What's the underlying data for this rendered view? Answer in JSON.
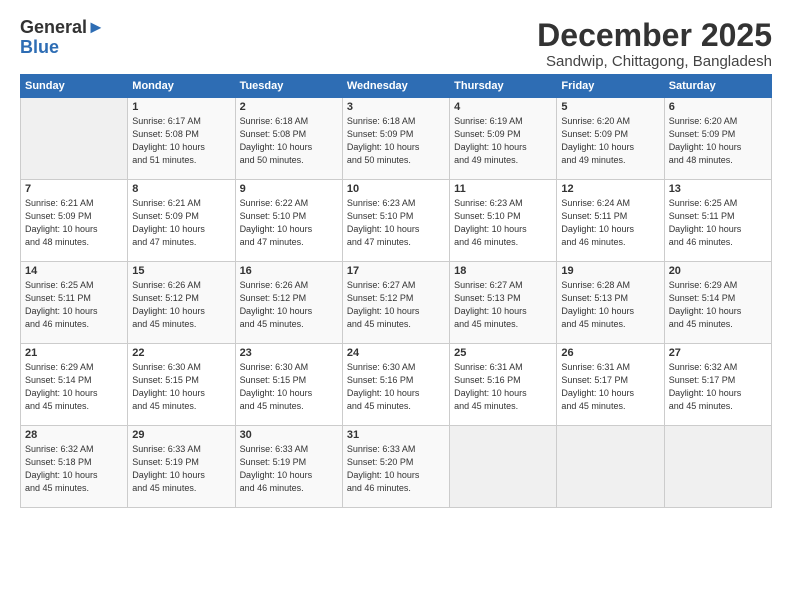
{
  "logo": {
    "general": "General",
    "blue": "Blue"
  },
  "title": "December 2025",
  "location": "Sandwip, Chittagong, Bangladesh",
  "days_of_week": [
    "Sunday",
    "Monday",
    "Tuesday",
    "Wednesday",
    "Thursday",
    "Friday",
    "Saturday"
  ],
  "weeks": [
    [
      {
        "day": "",
        "data": ""
      },
      {
        "day": "1",
        "data": "Sunrise: 6:17 AM\nSunset: 5:08 PM\nDaylight: 10 hours\nand 51 minutes."
      },
      {
        "day": "2",
        "data": "Sunrise: 6:18 AM\nSunset: 5:08 PM\nDaylight: 10 hours\nand 50 minutes."
      },
      {
        "day": "3",
        "data": "Sunrise: 6:18 AM\nSunset: 5:09 PM\nDaylight: 10 hours\nand 50 minutes."
      },
      {
        "day": "4",
        "data": "Sunrise: 6:19 AM\nSunset: 5:09 PM\nDaylight: 10 hours\nand 49 minutes."
      },
      {
        "day": "5",
        "data": "Sunrise: 6:20 AM\nSunset: 5:09 PM\nDaylight: 10 hours\nand 49 minutes."
      },
      {
        "day": "6",
        "data": "Sunrise: 6:20 AM\nSunset: 5:09 PM\nDaylight: 10 hours\nand 48 minutes."
      }
    ],
    [
      {
        "day": "7",
        "data": "Sunrise: 6:21 AM\nSunset: 5:09 PM\nDaylight: 10 hours\nand 48 minutes."
      },
      {
        "day": "8",
        "data": "Sunrise: 6:21 AM\nSunset: 5:09 PM\nDaylight: 10 hours\nand 47 minutes."
      },
      {
        "day": "9",
        "data": "Sunrise: 6:22 AM\nSunset: 5:10 PM\nDaylight: 10 hours\nand 47 minutes."
      },
      {
        "day": "10",
        "data": "Sunrise: 6:23 AM\nSunset: 5:10 PM\nDaylight: 10 hours\nand 47 minutes."
      },
      {
        "day": "11",
        "data": "Sunrise: 6:23 AM\nSunset: 5:10 PM\nDaylight: 10 hours\nand 46 minutes."
      },
      {
        "day": "12",
        "data": "Sunrise: 6:24 AM\nSunset: 5:11 PM\nDaylight: 10 hours\nand 46 minutes."
      },
      {
        "day": "13",
        "data": "Sunrise: 6:25 AM\nSunset: 5:11 PM\nDaylight: 10 hours\nand 46 minutes."
      }
    ],
    [
      {
        "day": "14",
        "data": "Sunrise: 6:25 AM\nSunset: 5:11 PM\nDaylight: 10 hours\nand 46 minutes."
      },
      {
        "day": "15",
        "data": "Sunrise: 6:26 AM\nSunset: 5:12 PM\nDaylight: 10 hours\nand 45 minutes."
      },
      {
        "day": "16",
        "data": "Sunrise: 6:26 AM\nSunset: 5:12 PM\nDaylight: 10 hours\nand 45 minutes."
      },
      {
        "day": "17",
        "data": "Sunrise: 6:27 AM\nSunset: 5:12 PM\nDaylight: 10 hours\nand 45 minutes."
      },
      {
        "day": "18",
        "data": "Sunrise: 6:27 AM\nSunset: 5:13 PM\nDaylight: 10 hours\nand 45 minutes."
      },
      {
        "day": "19",
        "data": "Sunrise: 6:28 AM\nSunset: 5:13 PM\nDaylight: 10 hours\nand 45 minutes."
      },
      {
        "day": "20",
        "data": "Sunrise: 6:29 AM\nSunset: 5:14 PM\nDaylight: 10 hours\nand 45 minutes."
      }
    ],
    [
      {
        "day": "21",
        "data": "Sunrise: 6:29 AM\nSunset: 5:14 PM\nDaylight: 10 hours\nand 45 minutes."
      },
      {
        "day": "22",
        "data": "Sunrise: 6:30 AM\nSunset: 5:15 PM\nDaylight: 10 hours\nand 45 minutes."
      },
      {
        "day": "23",
        "data": "Sunrise: 6:30 AM\nSunset: 5:15 PM\nDaylight: 10 hours\nand 45 minutes."
      },
      {
        "day": "24",
        "data": "Sunrise: 6:30 AM\nSunset: 5:16 PM\nDaylight: 10 hours\nand 45 minutes."
      },
      {
        "day": "25",
        "data": "Sunrise: 6:31 AM\nSunset: 5:16 PM\nDaylight: 10 hours\nand 45 minutes."
      },
      {
        "day": "26",
        "data": "Sunrise: 6:31 AM\nSunset: 5:17 PM\nDaylight: 10 hours\nand 45 minutes."
      },
      {
        "day": "27",
        "data": "Sunrise: 6:32 AM\nSunset: 5:17 PM\nDaylight: 10 hours\nand 45 minutes."
      }
    ],
    [
      {
        "day": "28",
        "data": "Sunrise: 6:32 AM\nSunset: 5:18 PM\nDaylight: 10 hours\nand 45 minutes."
      },
      {
        "day": "29",
        "data": "Sunrise: 6:33 AM\nSunset: 5:19 PM\nDaylight: 10 hours\nand 45 minutes."
      },
      {
        "day": "30",
        "data": "Sunrise: 6:33 AM\nSunset: 5:19 PM\nDaylight: 10 hours\nand 46 minutes."
      },
      {
        "day": "31",
        "data": "Sunrise: 6:33 AM\nSunset: 5:20 PM\nDaylight: 10 hours\nand 46 minutes."
      },
      {
        "day": "",
        "data": ""
      },
      {
        "day": "",
        "data": ""
      },
      {
        "day": "",
        "data": ""
      }
    ]
  ]
}
